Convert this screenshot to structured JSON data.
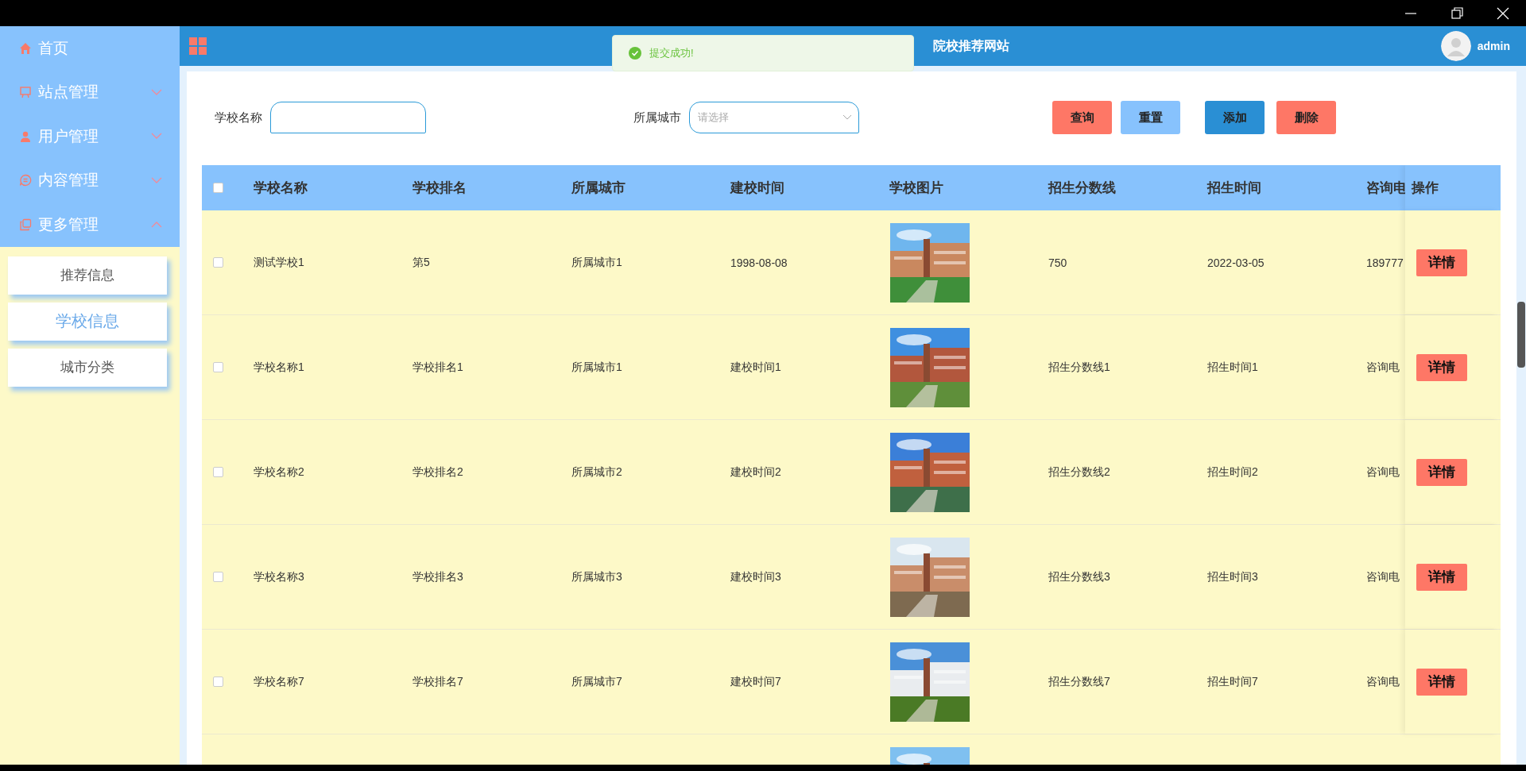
{
  "header": {
    "title": "院校推荐网站",
    "user": "admin"
  },
  "toast": {
    "message": "提交成功!"
  },
  "sidebar": {
    "items": [
      {
        "label": "首页",
        "kind": "home"
      },
      {
        "label": "站点管理",
        "kind": "site",
        "expanded": false
      },
      {
        "label": "用户管理",
        "kind": "user",
        "expanded": false
      },
      {
        "label": "内容管理",
        "kind": "content",
        "expanded": false
      },
      {
        "label": "更多管理",
        "kind": "more",
        "expanded": true,
        "children": [
          {
            "label": "推荐信息",
            "selected": false
          },
          {
            "label": "学校信息",
            "selected": true
          },
          {
            "label": "城市分类",
            "selected": false
          }
        ]
      }
    ]
  },
  "search": {
    "fields": [
      {
        "label": "学校名称",
        "kind": "input"
      },
      {
        "label": "所属城市",
        "kind": "select",
        "placeholder": "请选择"
      }
    ],
    "buttons": [
      {
        "label": "查询",
        "kind": "danger"
      },
      {
        "label": "重置",
        "kind": "light"
      },
      {
        "label": "添加",
        "kind": "primary"
      },
      {
        "label": "删除",
        "kind": "danger"
      }
    ]
  },
  "table": {
    "select_all": {
      "checked": false
    },
    "columns": [
      "学校名称",
      "学校排名",
      "所属城市",
      "建校时间",
      "学校图片",
      "招生分数线",
      "招生时间",
      "咨询电",
      "操作"
    ],
    "rows": [
      {
        "checked": false,
        "cells": [
          "测试学校1",
          "第5",
          "所属城市1",
          "1998-08-08"
        ],
        "image": {
          "kind": "picture"
        },
        "cells_after": [
          "750",
          "2022-03-05",
          "189777"
        ],
        "action": "详情"
      },
      {
        "checked": false,
        "cells": [
          "学校名称1",
          "学校排名1",
          "所属城市1",
          "建校时间1"
        ],
        "image": {
          "kind": "picture"
        },
        "cells_after": [
          "招生分数线1",
          "招生时间1",
          "咨询电"
        ],
        "action": "详情"
      },
      {
        "checked": false,
        "cells": [
          "学校名称2",
          "学校排名2",
          "所属城市2",
          "建校时间2"
        ],
        "image": {
          "kind": "picture"
        },
        "cells_after": [
          "招生分数线2",
          "招生时间2",
          "咨询电"
        ],
        "action": "详情"
      },
      {
        "checked": false,
        "cells": [
          "学校名称3",
          "学校排名3",
          "所属城市3",
          "建校时间3"
        ],
        "image": {
          "kind": "picture"
        },
        "cells_after": [
          "招生分数线3",
          "招生时间3",
          "咨询电"
        ],
        "action": "详情"
      },
      {
        "checked": false,
        "cells": [
          "学校名称7",
          "学校排名7",
          "所属城市7",
          "建校时间7"
        ],
        "image": {
          "kind": "picture"
        },
        "cells_after": [
          "招生分数线7",
          "招生时间7",
          "咨询电"
        ],
        "action": "详情"
      },
      {
        "image": {
          "kind": "picture"
        }
      }
    ]
  }
}
